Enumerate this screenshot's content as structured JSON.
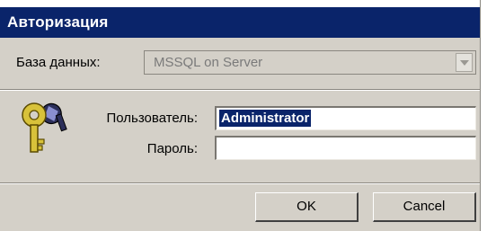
{
  "window": {
    "title": "Авторизация"
  },
  "database": {
    "label": "База данных:",
    "selected": "MSSQL on Server"
  },
  "login": {
    "user_label": "Пользователь:",
    "user_value": "Administrator",
    "password_label": "Пароль:",
    "password_value": ""
  },
  "buttons": {
    "ok": "OK",
    "cancel": "Cancel"
  },
  "icons": {
    "key": "keys-icon",
    "dropdown": "chevron-down-icon"
  },
  "colors": {
    "title_bar": "#0a246a",
    "dialog_bg": "#d4d0c8",
    "selection": "#0a246a"
  }
}
